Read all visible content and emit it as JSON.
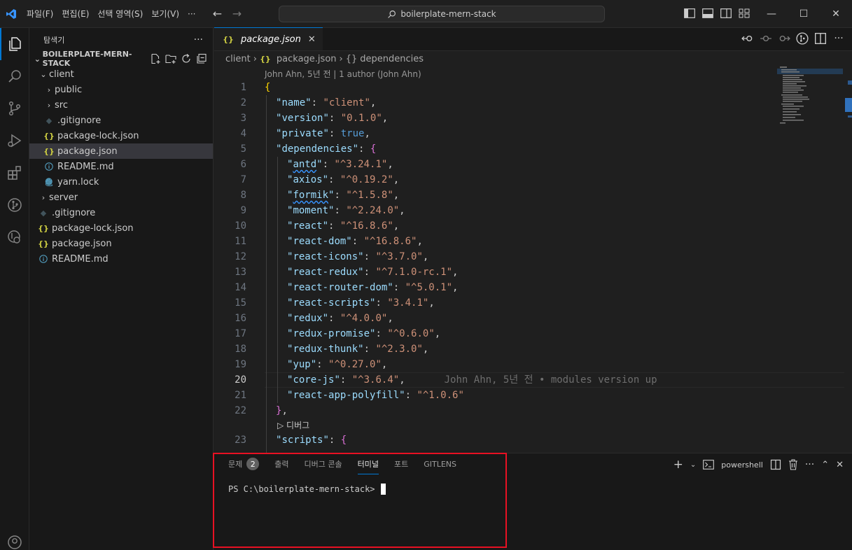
{
  "menu": [
    "파일(F)",
    "편집(E)",
    "선택 영역(S)",
    "보기(V)",
    "···"
  ],
  "search": {
    "text": "boilerplate-mern-stack"
  },
  "sidebar": {
    "title": "탐색기",
    "section": "BOILERPLATE-MERN-STACK",
    "items": [
      {
        "label": "client",
        "type": "folder-open",
        "depth": 1
      },
      {
        "label": "public",
        "type": "folder",
        "depth": 2
      },
      {
        "label": "src",
        "type": "folder",
        "depth": 2
      },
      {
        "label": ".gitignore",
        "type": "git",
        "depth": 2
      },
      {
        "label": "package-lock.json",
        "type": "json",
        "depth": 2
      },
      {
        "label": "package.json",
        "type": "json",
        "depth": 2,
        "selected": true
      },
      {
        "label": "README.md",
        "type": "info",
        "depth": 2
      },
      {
        "label": "yarn.lock",
        "type": "yarn",
        "depth": 2
      },
      {
        "label": "server",
        "type": "folder",
        "depth": 1
      },
      {
        "label": ".gitignore",
        "type": "git",
        "depth": 1
      },
      {
        "label": "package-lock.json",
        "type": "json",
        "depth": 1
      },
      {
        "label": "package.json",
        "type": "json",
        "depth": 1
      },
      {
        "label": "README.md",
        "type": "info",
        "depth": 1
      }
    ]
  },
  "editor": {
    "tab": "package.json",
    "breadcrumb": [
      "client",
      "package.json",
      "dependencies"
    ],
    "codelens": "John Ahn, 5년 전 | 1 author (John Ahn)",
    "blame": "John Ahn, 5년 전 • modules version up",
    "debug_lens": "디버그",
    "current_line": 20,
    "lines": [
      {
        "n": "1",
        "kind": "open-root"
      },
      {
        "n": "2",
        "kind": "kv",
        "indent": 1,
        "key": "name",
        "value": "\"client\"",
        "comma": true
      },
      {
        "n": "3",
        "kind": "kv",
        "indent": 1,
        "key": "version",
        "value": "\"0.1.0\"",
        "comma": true
      },
      {
        "n": "4",
        "kind": "kv",
        "indent": 1,
        "key": "private",
        "value": "true",
        "bool": true,
        "comma": true
      },
      {
        "n": "5",
        "kind": "obj-open",
        "indent": 1,
        "key": "dependencies"
      },
      {
        "n": "6",
        "kind": "kv",
        "indent": 2,
        "key": "antd",
        "value": "\"^3.24.1\"",
        "comma": true,
        "squig": true
      },
      {
        "n": "7",
        "kind": "kv",
        "indent": 2,
        "key": "axios",
        "value": "\"^0.19.2\"",
        "comma": true
      },
      {
        "n": "8",
        "kind": "kv",
        "indent": 2,
        "key": "formik",
        "value": "\"^1.5.8\"",
        "comma": true,
        "squig": true
      },
      {
        "n": "9",
        "kind": "kv",
        "indent": 2,
        "key": "moment",
        "value": "\"^2.24.0\"",
        "comma": true
      },
      {
        "n": "10",
        "kind": "kv",
        "indent": 2,
        "key": "react",
        "value": "\"^16.8.6\"",
        "comma": true
      },
      {
        "n": "11",
        "kind": "kv",
        "indent": 2,
        "key": "react-dom",
        "value": "\"^16.8.6\"",
        "comma": true
      },
      {
        "n": "12",
        "kind": "kv",
        "indent": 2,
        "key": "react-icons",
        "value": "\"^3.7.0\"",
        "comma": true
      },
      {
        "n": "13",
        "kind": "kv",
        "indent": 2,
        "key": "react-redux",
        "value": "\"^7.1.0-rc.1\"",
        "comma": true
      },
      {
        "n": "14",
        "kind": "kv",
        "indent": 2,
        "key": "react-router-dom",
        "value": "\"^5.0.1\"",
        "comma": true
      },
      {
        "n": "15",
        "kind": "kv",
        "indent": 2,
        "key": "react-scripts",
        "value": "\"3.4.1\"",
        "comma": true
      },
      {
        "n": "16",
        "kind": "kv",
        "indent": 2,
        "key": "redux",
        "value": "\"^4.0.0\"",
        "comma": true
      },
      {
        "n": "17",
        "kind": "kv",
        "indent": 2,
        "key": "redux-promise",
        "value": "\"^0.6.0\"",
        "comma": true
      },
      {
        "n": "18",
        "kind": "kv",
        "indent": 2,
        "key": "redux-thunk",
        "value": "\"^2.3.0\"",
        "comma": true
      },
      {
        "n": "19",
        "kind": "kv",
        "indent": 2,
        "key": "yup",
        "value": "\"^0.27.0\"",
        "comma": true
      },
      {
        "n": "20",
        "kind": "kv",
        "indent": 2,
        "key": "core-js",
        "value": "\"^3.6.4\"",
        "comma": true,
        "blame": true
      },
      {
        "n": "21",
        "kind": "kv",
        "indent": 2,
        "key": "react-app-polyfill",
        "value": "\"^1.0.6\"",
        "comma": false
      },
      {
        "n": "22",
        "kind": "obj-close",
        "indent": 1
      },
      {
        "n": "",
        "kind": "debug"
      },
      {
        "n": "23",
        "kind": "obj-open",
        "indent": 1,
        "key": "scripts"
      }
    ]
  },
  "panel": {
    "tabs": [
      "문제",
      "출력",
      "디버그 콘솔",
      "터미널",
      "포트",
      "GITLENS"
    ],
    "problems_count": "2",
    "active_tab": "터미널",
    "shell": "powershell",
    "prompt": "PS C:\\boilerplate-mern-stack>"
  },
  "colors": {
    "accent": "#0078d4",
    "highlight": "#e81123",
    "json_icon": "#cbcb41"
  }
}
